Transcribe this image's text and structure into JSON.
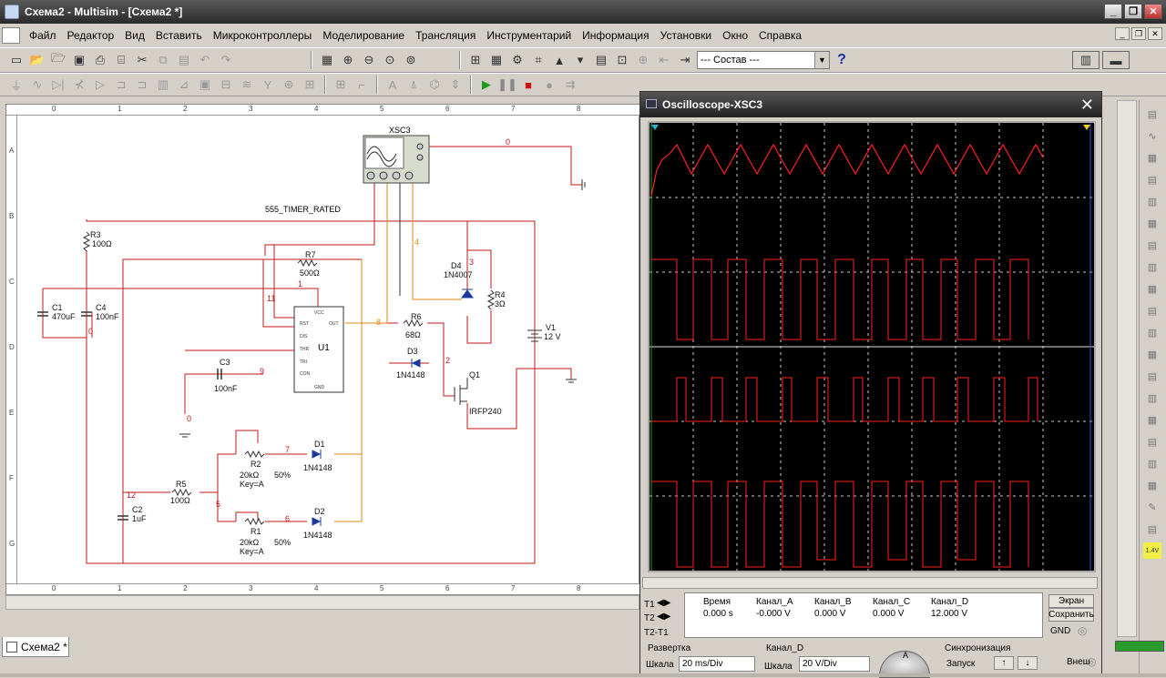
{
  "app": {
    "title": "Схема2 - Multisim - [Схема2 *]"
  },
  "menu": [
    "Файл",
    "Редактор",
    "Вид",
    "Вставить",
    "Микроконтроллеры",
    "Моделирование",
    "Трансляция",
    "Инструментарий",
    "Информация",
    "Установки",
    "Окно",
    "Справка"
  ],
  "toolbar": {
    "combo_value": "--- Состав ---",
    "help_label": "?"
  },
  "ruler": {
    "columns": [
      "0",
      "1",
      "2",
      "3",
      "4",
      "5",
      "6",
      "7",
      "8"
    ],
    "rows": [
      "A",
      "B",
      "C",
      "D",
      "E",
      "F",
      "G"
    ]
  },
  "schematic": {
    "scope_label": "XSC3",
    "timer_label": "555_TIMER_RATED",
    "labels": {
      "r3": "R3",
      "r3v": "100Ω",
      "r7": "R7",
      "r7v": "500Ω",
      "c1": "C1",
      "c1v": "470uF",
      "c4": "C4",
      "c4v": "100nF",
      "u1": "U1",
      "c3": "C3",
      "c3v": "100nF",
      "r6": "R6",
      "r6v": "68Ω",
      "d3": "D3",
      "d3v": "1N4148",
      "d4": "D4",
      "d4v": "1N4007",
      "r4": "R4",
      "r4v": "3Ω",
      "v1": "V1",
      "v1v": "12 V",
      "q1": "Q1",
      "q1v": "IRFP240",
      "r2": "R2",
      "r2v": "20kΩ",
      "r2k": "Key=A",
      "r2p": "50%",
      "d1": "D1",
      "d1v": "1N4148",
      "r5": "R5",
      "r5v": "100Ω",
      "c2": "C2",
      "c2v": "1uF",
      "r1": "R1",
      "r1v": "20kΩ",
      "r1k": "Key=A",
      "r1p": "50%",
      "d2": "D2",
      "d2v": "1N4148"
    },
    "nodes": {
      "n0a": "0",
      "n0b": "0",
      "n0c": "0",
      "n1": "1",
      "n2": "2",
      "n3": "3",
      "n4": "4",
      "n5": "5",
      "n6": "6",
      "n7": "7",
      "n8": "8",
      "n9": "9",
      "n11": "11",
      "n12": "12"
    },
    "pins": {
      "vcc": "VCC",
      "rst": "RST",
      "dis": "DIS",
      "thr": "THR",
      "tri": "TRI",
      "con": "CON",
      "out": "OUT",
      "gnd": "GND"
    }
  },
  "tabs": [
    {
      "label": "Схема2 *"
    }
  ],
  "oscilloscope": {
    "title": "Oscilloscope-XSC3",
    "readout": {
      "headers": [
        "Время",
        "Канал_A",
        "Канал_B",
        "Канал_C",
        "Канал_D"
      ],
      "t1": [
        "0.000 s",
        "-0.000 V",
        "0.000 V",
        "0.000 V",
        "12.000 V"
      ],
      "t1_label": "T1",
      "t2_label": "T2",
      "t2t1_label": "T2-T1"
    },
    "buttons": {
      "screen": "Экран",
      "save": "Сохранить",
      "gnd": "GND"
    },
    "timebase": {
      "section": "Развертка",
      "scale_label": "Шкала",
      "scale_value": "20 ms/Div"
    },
    "channel_d": {
      "section": "Канал_D",
      "scale_label": "Шкала",
      "scale_value": "20  V/Div"
    },
    "trigger": {
      "section": "Синхронизация",
      "mode_label": "Запуск",
      "ext_label": "Внеш"
    },
    "knob_label": "A",
    "colors": {
      "trace": "#ff2020",
      "grid": "#c8c8c8",
      "background": "#000000"
    }
  },
  "status": {
    "scale_badge": "1.4V"
  }
}
